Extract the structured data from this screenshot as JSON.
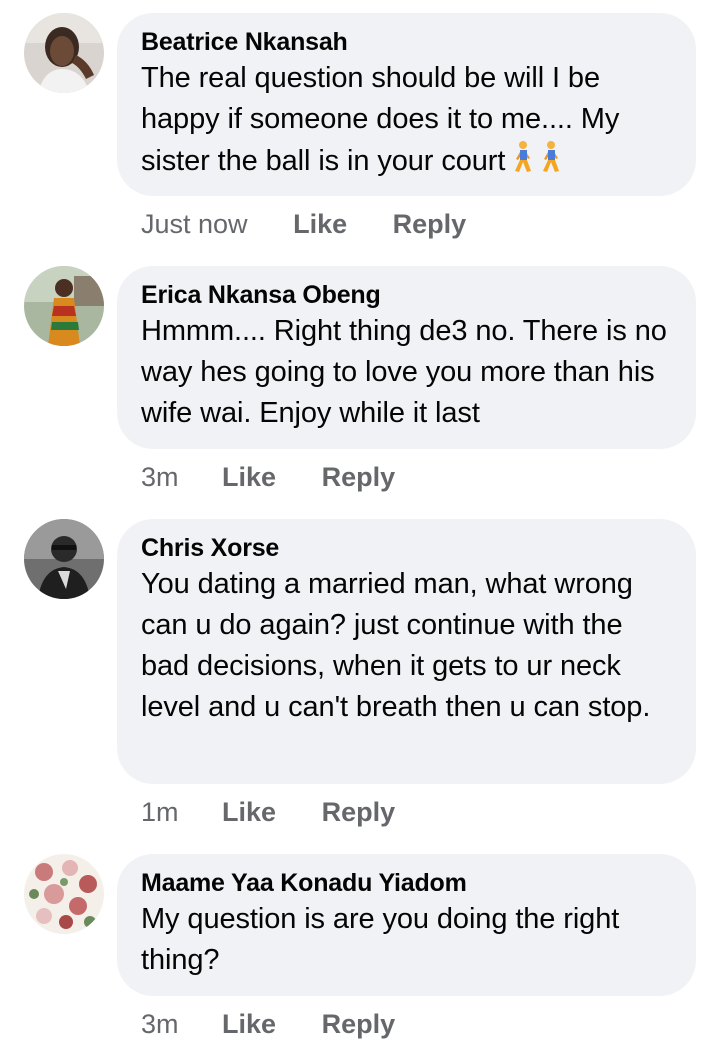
{
  "comments": [
    {
      "author": "Beatrice Nkansah",
      "text": "The real question should be will I be happy if someone does it to me.... My sister the ball is in your court",
      "emoji_icons": [
        "person-walking-icon",
        "person-walking-icon"
      ],
      "time": "Just now",
      "like_label": "Like",
      "reply_label": "Reply"
    },
    {
      "author": "Erica Nkansa Obeng",
      "text": "Hmmm.... Right thing de3 no. There is no way hes going to love you more than his wife wai. Enjoy while it last",
      "time": "3m",
      "like_label": "Like",
      "reply_label": "Reply"
    },
    {
      "author": "Chris Xorse",
      "text": "You dating a married man, what wrong can u do again? just continue with the bad decisions, when it gets to ur neck level and u can't breath then u can stop.",
      "time": "1m",
      "like_label": "Like",
      "reply_label": "Reply"
    },
    {
      "author": "Maame Yaa Konadu Yiadom",
      "text": "My question is are you doing the right thing?",
      "time": "3m",
      "like_label": "Like",
      "reply_label": "Reply"
    }
  ],
  "colors": {
    "bubble": "#f0f2f5",
    "text": "#050505",
    "meta": "#65676b"
  }
}
